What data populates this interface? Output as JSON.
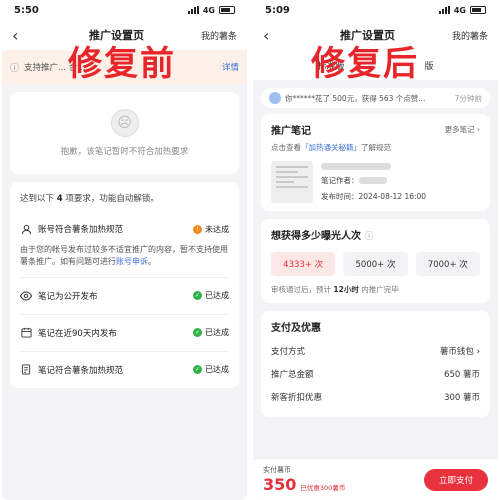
{
  "left": {
    "status_time": "5:50",
    "network": "4G",
    "title": "推广设置页",
    "right_link": "我的薯条",
    "overlay_label": "修复前",
    "notice_text": "支持推广... 合...",
    "notice_detail": "详情",
    "empty_text": "抱歉，该笔记暂时不符合加热要求",
    "requirements_prefix": "达到以下",
    "requirements_count": "4",
    "requirements_suffix": "项要求，功能自动解锁。",
    "requirements": [
      {
        "icon": "user-icon",
        "label": "账号符合薯条加热规范",
        "status": "未达成",
        "ok": false
      },
      {
        "icon": "eye-icon",
        "label": "笔记为公开发布",
        "status": "已达成",
        "ok": true
      },
      {
        "icon": "calendar-icon",
        "label": "笔记在近90天内发布",
        "status": "已达成",
        "ok": true
      },
      {
        "icon": "document-icon",
        "label": "笔记符合薯条加热规范",
        "status": "已达成",
        "ok": true
      }
    ],
    "account_desc": "由于您的帐号发布过较多不适宜推广的内容，暂不支持使用薯条推广。如有问题可进行",
    "account_desc_link": "账号申诉",
    "account_desc_end": "。"
  },
  "right": {
    "status_time": "5:09",
    "network": "4G",
    "title": "推广设置页",
    "right_link": "我的薯条",
    "overlay_label": "修复后",
    "mode_left": "标准版",
    "mode_right": "版",
    "ticker_text": "你******花了 500元，获得 563 个点赞...",
    "ticker_time": "7分钟前",
    "note_section_title": "推广笔记",
    "note_section_more": "更多笔记",
    "note_hint_prefix": "点击查看",
    "note_hint_link": "「加热通关秘籍」",
    "note_hint_suffix": "了解规范",
    "note_author_label": "笔记作者：",
    "note_time": "发布时间：2024-08-12 16:00",
    "exposure_title": "想获得多少曝光人次",
    "options": [
      "4333+ 次",
      "5000+ 次",
      "7000+ 次"
    ],
    "selected_option": 0,
    "review_prefix": "审核通过后，预计",
    "review_hours": "12小时",
    "review_suffix": "内推广完毕",
    "pay_title": "支付及优惠",
    "pay_rows": [
      {
        "label": "支付方式",
        "value": "薯币钱包 ›"
      },
      {
        "label": "推广总金额",
        "value": "650 薯币"
      },
      {
        "label": "新客折扣优惠",
        "value": "300 薯币"
      }
    ],
    "footer_label": "实付薯币",
    "footer_amount": "350",
    "footer_saved": "已优惠300薯币",
    "pay_button": "立即支付"
  },
  "colors": {
    "accent_red": "#e8323e",
    "ok_green": "#2fb34a",
    "warn_orange": "#f08a1c",
    "link_blue": "#3a6fd8"
  }
}
